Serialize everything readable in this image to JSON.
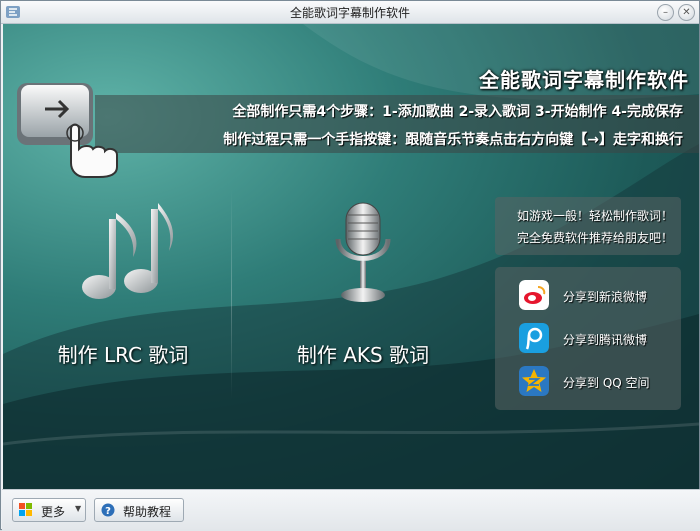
{
  "window": {
    "title": "全能歌词字幕制作软件"
  },
  "banner": {
    "brand": "全能歌词字幕制作软件",
    "line1": "全部制作只需4个步骤：1-添加歌曲  2-录入歌词  3-开始制作  4-完成保存",
    "line2": "制作过程只需一个手指按键：跟随音乐节奏点击右方向键【→】走字和换行"
  },
  "actions": {
    "lrc_label": "制作 LRC 歌词",
    "aks_label": "制作 AKS 歌词"
  },
  "tagline": {
    "line1": "如游戏一般！轻松制作歌词！",
    "line2": "完全免费软件推荐给朋友吧！"
  },
  "share": [
    {
      "label": "分享到新浪微博",
      "icon": "weibo-icon",
      "color": "#e6162d"
    },
    {
      "label": "分享到腾讯微博",
      "icon": "tencent-weibo-icon",
      "color": "#1a9fe0"
    },
    {
      "label": "分享到 QQ 空间",
      "icon": "qzone-icon",
      "color": "#f5b400"
    }
  ],
  "statusbar": {
    "more_label": "更多",
    "help_label": "帮助教程"
  }
}
